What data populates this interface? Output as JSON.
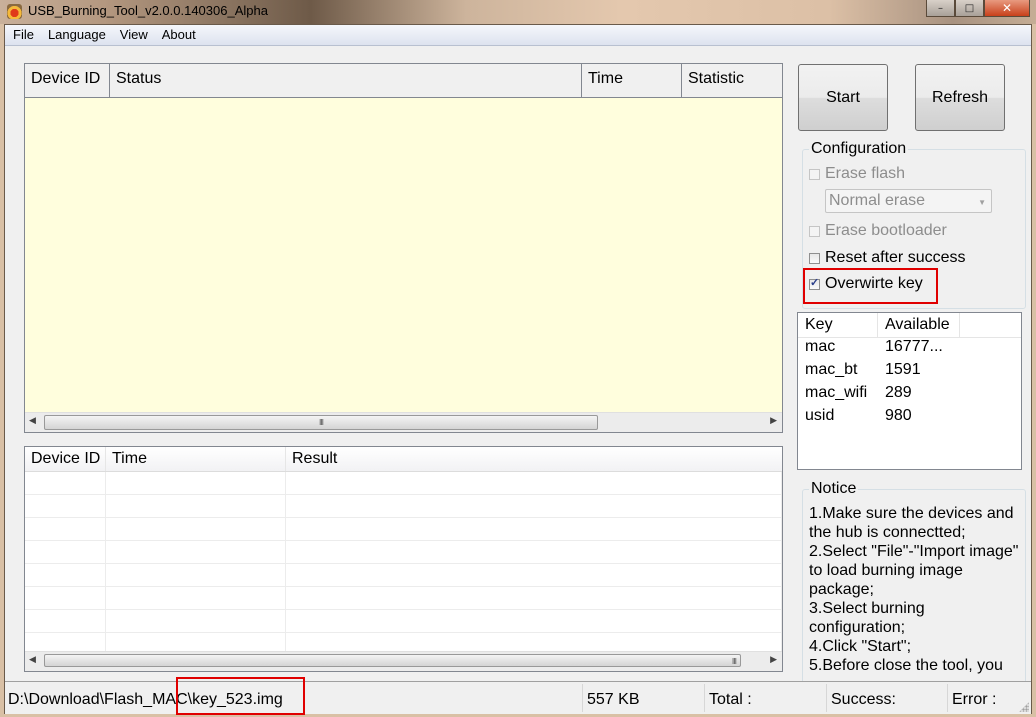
{
  "window": {
    "title": "USB_Burning_Tool_v2.0.0.140306_Alpha",
    "controls": {
      "minimize": "–",
      "maximize": "□",
      "close": "✕"
    }
  },
  "menu": [
    "File",
    "Language",
    "View",
    "About"
  ],
  "device_grid": {
    "columns": [
      "Device ID",
      "Status",
      "Time",
      "Statistic"
    ],
    "rows": [],
    "scroll_thumb": "III"
  },
  "result_grid": {
    "columns": [
      "Device ID",
      "Time",
      "Result"
    ],
    "rows": [
      [
        "",
        "",
        ""
      ],
      [
        "",
        "",
        ""
      ],
      [
        "",
        "",
        ""
      ],
      [
        "",
        "",
        ""
      ],
      [
        "",
        "",
        ""
      ],
      [
        "",
        "",
        ""
      ],
      [
        "",
        "",
        ""
      ],
      [
        "",
        "",
        ""
      ]
    ],
    "scroll_thumb": "III"
  },
  "buttons": {
    "start": "Start",
    "refresh": "Refresh"
  },
  "configuration": {
    "title": "Configuration",
    "erase_flash": {
      "label": "Erase flash",
      "checked": false,
      "enabled": false
    },
    "erase_mode": {
      "value": "Normal erase",
      "enabled": false
    },
    "erase_bootloader": {
      "label": "Erase bootloader",
      "checked": false,
      "enabled": false
    },
    "reset_after_success": {
      "label": "Reset after success",
      "checked": false,
      "enabled": true
    },
    "overwrite_key": {
      "label": "Overwirte key",
      "checked": true,
      "enabled": true
    }
  },
  "keys": {
    "columns": [
      "Key",
      "Available"
    ],
    "rows": [
      [
        "mac",
        "16777..."
      ],
      [
        "mac_bt",
        "1591"
      ],
      [
        "mac_wifi",
        "289"
      ],
      [
        "usid",
        "980"
      ]
    ]
  },
  "notice": {
    "title": "Notice",
    "text": "1.Make sure the devices and the hub is connectted;\n2.Select \"File\"-\"Import image\" to load burning image package;\n3.Select burning configuration;\n4.Click \"Start\";\n5.Before close the tool, you"
  },
  "status_bar": {
    "path": "D:\\Download\\Flash_MAC\\key_523.img",
    "size": "557 KB",
    "total": "Total :",
    "success": "Success:",
    "error": "Error :"
  },
  "colors": {
    "highlight": "#e00000",
    "grid_bg": "#fffedd"
  }
}
